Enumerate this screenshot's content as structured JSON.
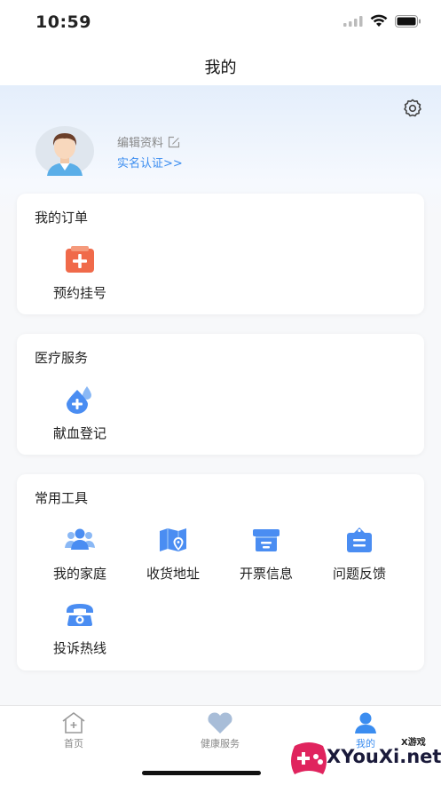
{
  "status_bar": {
    "time": "10:59"
  },
  "header": {
    "title": "我的"
  },
  "profile": {
    "edit_label": "编辑资料",
    "realname_label": "实名认证>>"
  },
  "orders": {
    "title": "我的订单",
    "items": [
      {
        "label": "预约挂号",
        "icon": "appointment-icon"
      }
    ]
  },
  "medical": {
    "title": "医疗服务",
    "items": [
      {
        "label": "献血登记",
        "icon": "blood-drop-icon"
      }
    ]
  },
  "tools": {
    "title": "常用工具",
    "items": [
      {
        "label": "我的家庭",
        "icon": "family-icon"
      },
      {
        "label": "收货地址",
        "icon": "map-icon"
      },
      {
        "label": "开票信息",
        "icon": "invoice-icon"
      },
      {
        "label": "问题反馈",
        "icon": "feedback-icon"
      },
      {
        "label": "投诉热线",
        "icon": "phone-icon"
      }
    ]
  },
  "tabs": [
    {
      "label": "首页",
      "icon": "home-icon"
    },
    {
      "label": "健康服务",
      "icon": "heart-icon"
    },
    {
      "label": "我的",
      "icon": "user-icon"
    }
  ],
  "watermark": {
    "text": "XYouXi.net",
    "small": "X游戏"
  },
  "colors": {
    "accent": "#3b8df0",
    "icon_blue": "#4a8df2",
    "order_orange": "#f06a4a"
  }
}
